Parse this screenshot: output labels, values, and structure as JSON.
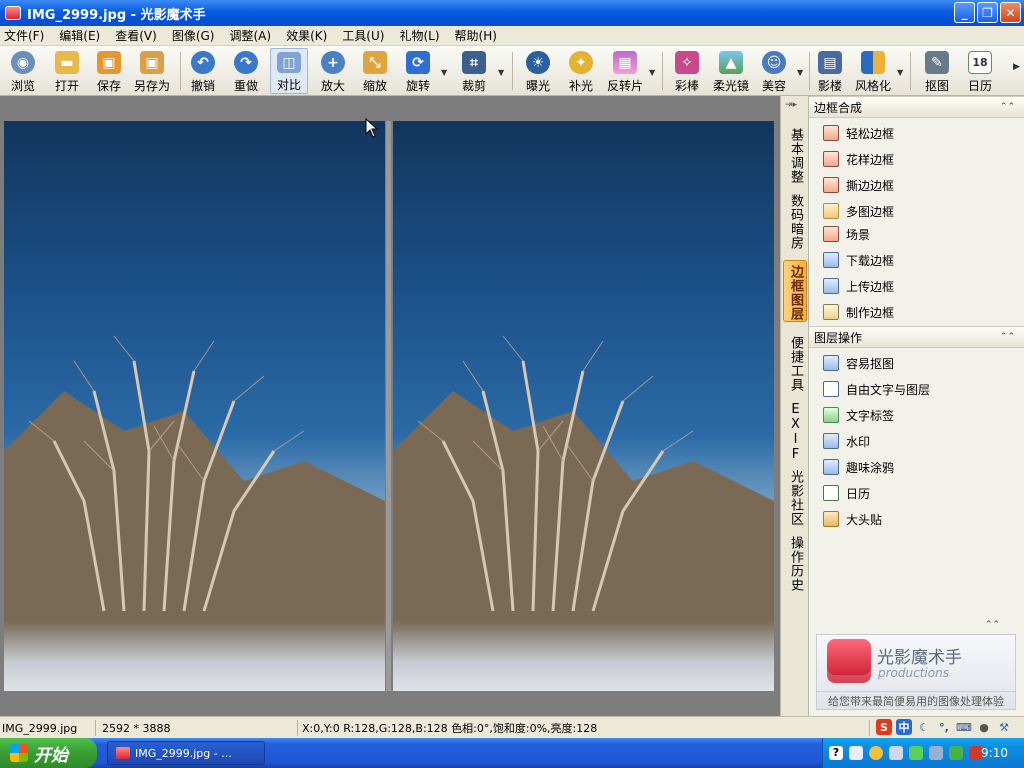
{
  "window": {
    "title": "IMG_2999.jpg - 光影魔术手"
  },
  "menu": [
    "文件(F)",
    "编辑(E)",
    "查看(V)",
    "图像(G)",
    "调整(A)",
    "效果(K)",
    "工具(U)",
    "礼物(L)",
    "帮助(H)"
  ],
  "toolbar": {
    "browse": "浏览",
    "open": "打开",
    "save": "保存",
    "save_as": "另存为",
    "undo": "撤销",
    "redo": "重做",
    "compare": "对比",
    "zoom_in": "放大",
    "scale": "缩放",
    "rotate": "旋转",
    "crop": "裁剪",
    "exposure": "曝光",
    "fill_light": "补光",
    "negative": "反转片",
    "color_stick": "彩棒",
    "soft_lens": "柔光镜",
    "beauty": "美容",
    "studio": "影楼",
    "stylize": "风格化",
    "cutout": "抠图",
    "calendar": "日历"
  },
  "vtabs": [
    "基本调整",
    "数码暗房",
    "边框图层",
    "便捷工具",
    "EXIF",
    "光影社区",
    "操作历史"
  ],
  "frame_section": {
    "title": "边框合成",
    "items": [
      "轻松边框",
      "花样边框",
      "撕边边框",
      "多图边框",
      "场景",
      "下载边框",
      "上传边框",
      "制作边框"
    ]
  },
  "layer_section": {
    "title": "图层操作",
    "items": [
      "容易抠图",
      "自由文字与图层",
      "文字标签",
      "水印",
      "趣味涂鸦",
      "日历",
      "大头贴"
    ]
  },
  "brand": {
    "name": "光影魔术手",
    "sub": "productions",
    "slogan": "给您带来最简便易用的图像处理体验"
  },
  "status": {
    "filename": "IMG_2999.jpg",
    "dimensions": "2592 * 3888",
    "pixel_info": "X:0,Y:0 R:128,G:128,B:128 色相:0°,饱和度:0%,亮度:128"
  },
  "taskbar": {
    "start": "开始",
    "task_item": "IMG_2999.jpg - ...",
    "clock": "9:10"
  },
  "colors": {
    "accent": "#0a5ce0",
    "tab_active": "#f7b23a",
    "taskbar": "#245edb"
  }
}
